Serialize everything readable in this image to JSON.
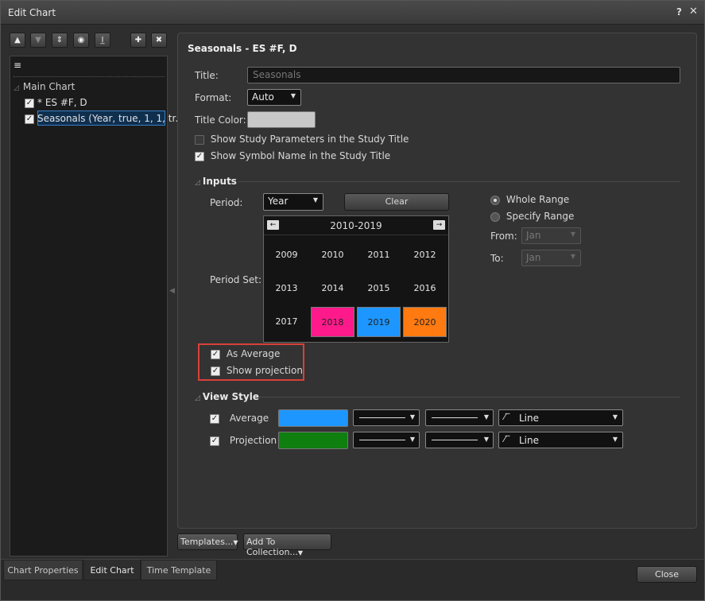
{
  "window": {
    "title": "Edit Chart",
    "help": "?",
    "close": "✕"
  },
  "toolbar": {
    "move_up": "▲",
    "move_down": "▼",
    "sort": "⇕",
    "eye": "◉",
    "insert": "I̲",
    "add": "✚",
    "remove": "✖"
  },
  "tree": {
    "list_icon": "≡",
    "main_chart": "Main Chart",
    "items": [
      {
        "label": "* ES #F, D",
        "checked": true
      },
      {
        "label": "Seasonals (Year, true, 1, 1, tr...",
        "checked": true
      }
    ]
  },
  "panel": {
    "heading": "Seasonals - ES #F, D",
    "title_label": "Title:",
    "title_placeholder": "Seasonals",
    "format_label": "Format:",
    "format_value": "Auto",
    "title_color_label": "Title Color:",
    "title_color": "#c8c8c8",
    "show_params_label": "Show Study Parameters in the Study Title",
    "show_params_checked": false,
    "show_symbol_label": "Show Symbol Name in the Study Title",
    "show_symbol_checked": true
  },
  "inputs": {
    "section": "Inputs",
    "period_label": "Period:",
    "period_value": "Year",
    "clear_label": "Clear",
    "period_set_label": "Period Set:",
    "calendar": {
      "range": "2010-2019",
      "prev": "←",
      "next": "→",
      "years": [
        {
          "label": "2009",
          "color": ""
        },
        {
          "label": "2010",
          "color": ""
        },
        {
          "label": "2011",
          "color": ""
        },
        {
          "label": "2012",
          "color": ""
        },
        {
          "label": "2013",
          "color": ""
        },
        {
          "label": "2014",
          "color": ""
        },
        {
          "label": "2015",
          "color": ""
        },
        {
          "label": "2016",
          "color": ""
        },
        {
          "label": "2017",
          "color": ""
        },
        {
          "label": "2018",
          "color": "#ff1a8c"
        },
        {
          "label": "2019",
          "color": "#1e96ff"
        },
        {
          "label": "2020",
          "color": "#ff7a10"
        }
      ]
    },
    "whole_range_label": "Whole Range",
    "specify_range_label": "Specify Range",
    "from_label": "From:",
    "from_value": "Jan",
    "to_label": "To:",
    "to_value": "Jan",
    "as_average_label": "As Average",
    "show_projection_label": "Show projection"
  },
  "view_style": {
    "section": "View Style",
    "rows": [
      {
        "label": "Average",
        "color": "#1e96ff",
        "type": "Line"
      },
      {
        "label": "Projection",
        "color": "#0f7f0f",
        "type": "Line"
      }
    ]
  },
  "bottom": {
    "templates_label": "Templates...",
    "add_collection_label": "Add To Collection...",
    "tabs": [
      "Chart Properties",
      "Edit Chart",
      "Time Template"
    ],
    "close_label": "Close"
  }
}
